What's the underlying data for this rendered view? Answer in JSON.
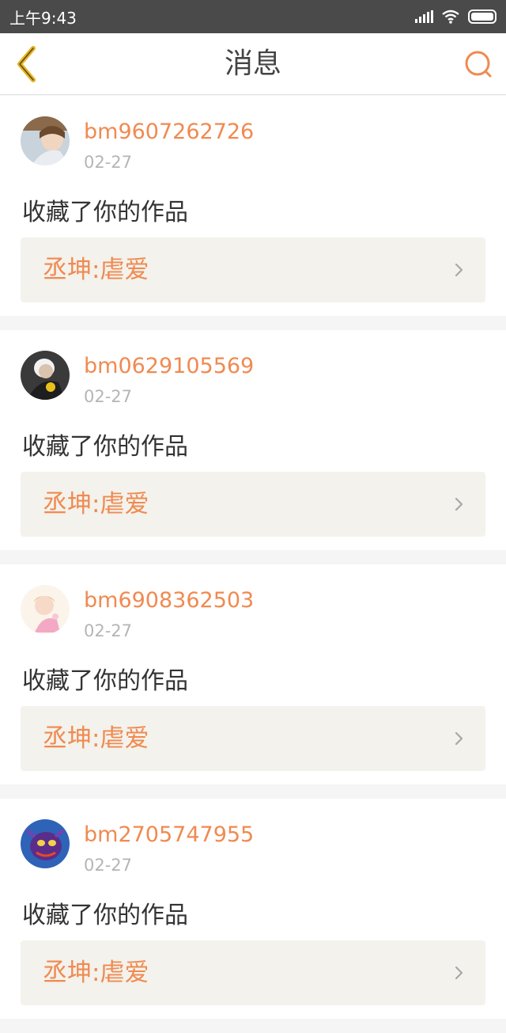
{
  "status_bar": {
    "time": "上午9:43"
  },
  "nav": {
    "title": "消息",
    "back_icon": "chevron-left-icon",
    "search_icon": "search-icon",
    "accent_color": "#f08a50",
    "back_color": "#e6b422"
  },
  "messages": [
    {
      "username": "bm9607262726",
      "date": "02-27",
      "action": "收藏了你的作品",
      "work": "丞坤:虐爱",
      "avatar_icon": "user-avatar-photo"
    },
    {
      "username": "bm0629105569",
      "date": "02-27",
      "action": "收藏了你的作品",
      "work": "丞坤:虐爱",
      "avatar_icon": "user-avatar-photo"
    },
    {
      "username": "bm6908362503",
      "date": "02-27",
      "action": "收藏了你的作品",
      "work": "丞坤:虐爱",
      "avatar_icon": "user-avatar-illustration"
    },
    {
      "username": "bm2705747955",
      "date": "02-27",
      "action": "收藏了你的作品",
      "work": "丞坤:虐爱",
      "avatar_icon": "user-avatar-illustration"
    }
  ]
}
